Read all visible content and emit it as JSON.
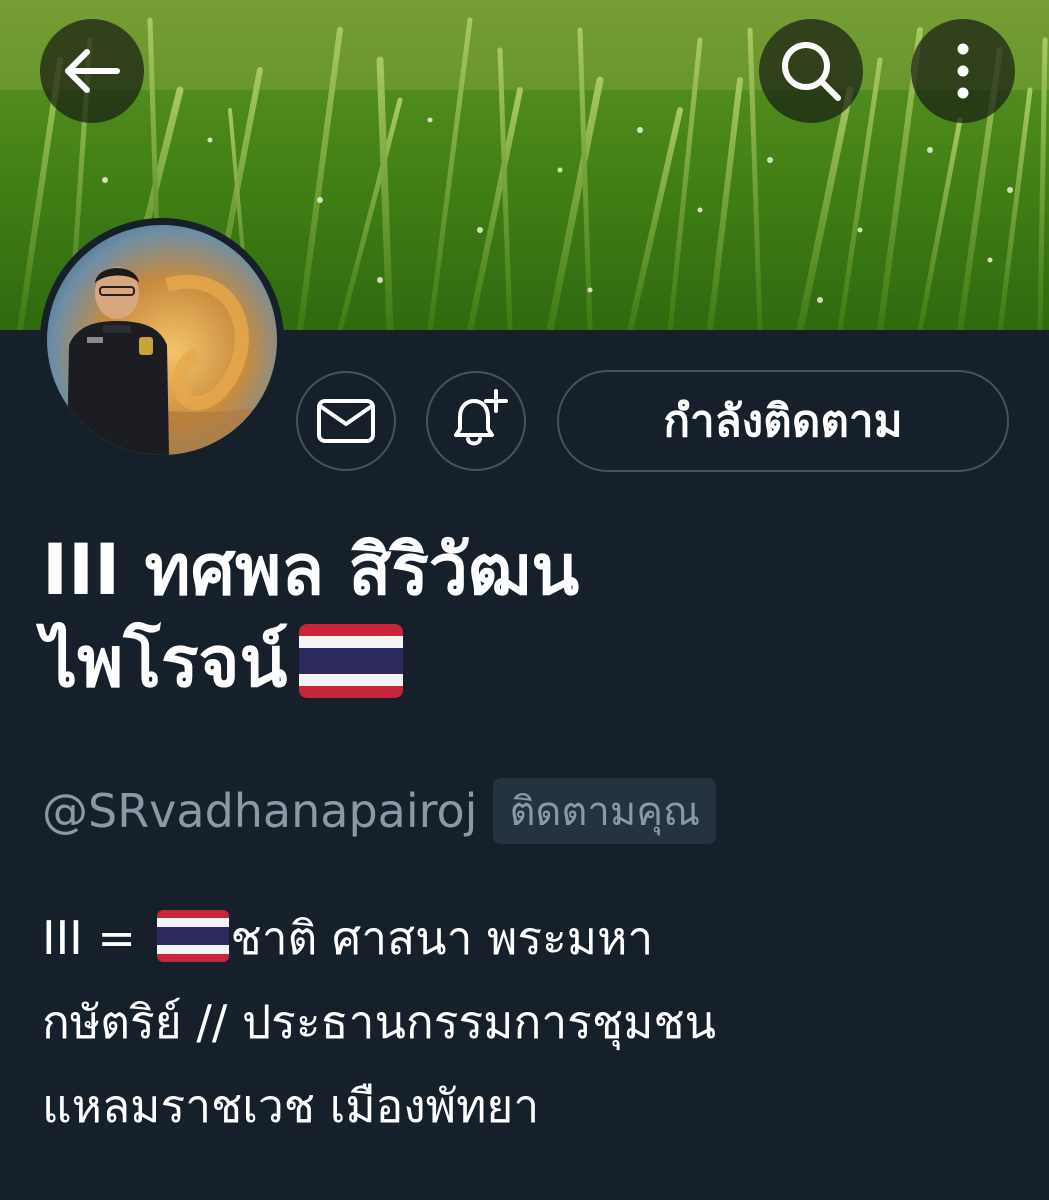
{
  "header": {
    "back_icon": "arrow-left-icon",
    "search_icon": "search-icon",
    "more_icon": "more-vertical-icon"
  },
  "profile": {
    "display_name_line1": "III ทศพล สิริวัฒน",
    "display_name_line2": "ไพโรจน์",
    "handle": "@SRvadhanapairoj",
    "follows_you_badge": "ติดตามคุณ",
    "bio_part1": "III = ",
    "bio_part2": "ชาติ ศาสนา พระมหา",
    "bio_line2": "กษัตริย์ // ประธานกรรมการชุมชน",
    "bio_line3": "แหลมราชเวช เมืองพัทยา"
  },
  "actions": {
    "message_icon": "mail-icon",
    "notify_icon": "bell-plus-icon",
    "following_label": "กำลังติดตาม"
  },
  "colors": {
    "background": "#15202b",
    "muted_text": "#8b98a5",
    "border": "#425364",
    "badge_bg": "#253341"
  }
}
